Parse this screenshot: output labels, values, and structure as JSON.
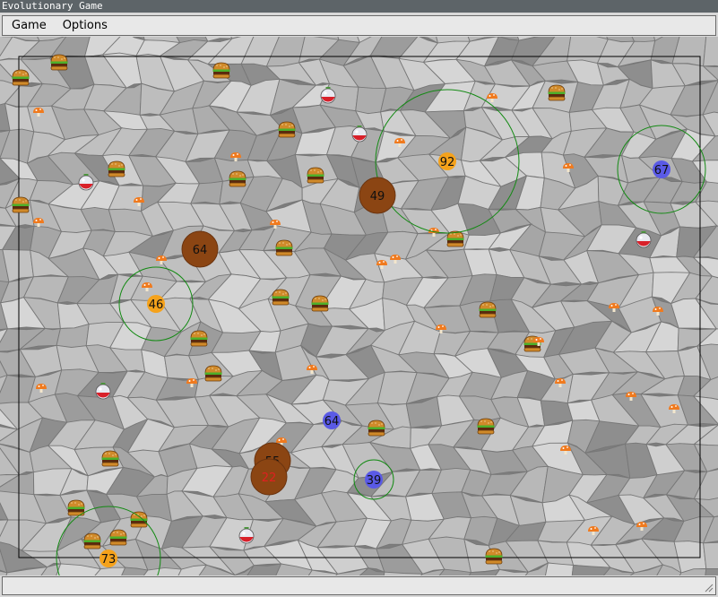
{
  "window": {
    "title": "Evolutionary Game"
  },
  "menu": [
    {
      "id": "game",
      "label": "Game"
    },
    {
      "id": "options",
      "label": "Options"
    }
  ],
  "colors": {
    "creature_orange": "#f5a21b",
    "creature_blue": "#5a5ae6",
    "creature_brown": "#8b4513",
    "vision_ring": "#138a13",
    "stone_light": "#c3c3c3",
    "stone_dark": "#8f8f8f"
  },
  "creatures": [
    {
      "label": "92",
      "kind": "orange",
      "vision": true
    },
    {
      "label": "67",
      "kind": "blue",
      "vision": true
    },
    {
      "label": "49",
      "kind": "brown",
      "vision": false
    },
    {
      "label": "64",
      "kind": "brown",
      "vision": false
    },
    {
      "label": "46",
      "kind": "orange",
      "vision": true
    },
    {
      "label": "64",
      "kind": "blue",
      "vision": false
    },
    {
      "label": "55",
      "kind": "brown",
      "vision": false
    },
    {
      "label": "22",
      "kind": "brown",
      "vision": false,
      "label_color": "#e02020"
    },
    {
      "label": "39",
      "kind": "blue",
      "vision": true
    },
    {
      "label": "73",
      "kind": "orange",
      "vision": true
    }
  ],
  "food": {
    "burger_icon": "burger-icon",
    "mushroom_icon": "mushroom-icon",
    "potion_icon": "potion-icon"
  }
}
